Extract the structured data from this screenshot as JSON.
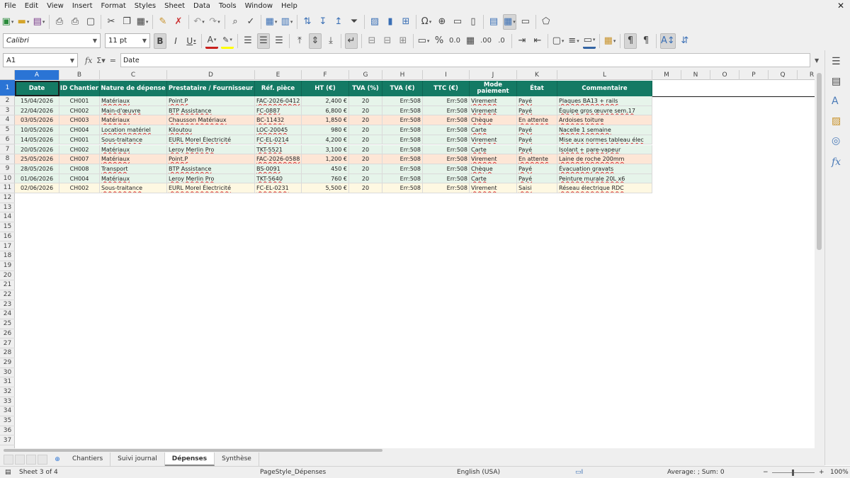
{
  "menu": [
    "File",
    "Edit",
    "View",
    "Insert",
    "Format",
    "Styles",
    "Sheet",
    "Data",
    "Tools",
    "Window",
    "Help"
  ],
  "font": {
    "name": "Calibri",
    "size": "11 pt"
  },
  "namebox": "A1",
  "formula": "Date",
  "columns": [
    "A",
    "B",
    "C",
    "D",
    "E",
    "F",
    "G",
    "H",
    "I",
    "J",
    "K",
    "L",
    "M",
    "N",
    "O",
    "P",
    "Q",
    "R"
  ],
  "header": [
    "Date",
    "ID Chantier",
    "Nature de dépense",
    "Prestataire / Fournisseur",
    "Réf. pièce",
    "HT (€)",
    "TVA (%)",
    "TVA (€)",
    "TTC (€)",
    "Mode paiement",
    "État",
    "Commentaire"
  ],
  "rows": [
    [
      "15/04/2026",
      "CH001",
      "Matériaux",
      "Point.P",
      "FAC-2026-0412",
      "2,400 €",
      "20",
      "Err:508",
      "Err:508",
      "Virement",
      "Payé",
      "Plaques BA13 + rails"
    ],
    [
      "22/04/2026",
      "CH002",
      "Main-d'œuvre",
      "BTP Assistance",
      "FC-0887",
      "6,800 €",
      "20",
      "Err:508",
      "Err:508",
      "Virement",
      "Payé",
      "Équipe gros œuvre sem.17"
    ],
    [
      "03/05/2026",
      "CH003",
      "Matériaux",
      "Chausson Matériaux",
      "BC-11432",
      "1,850 €",
      "20",
      "Err:508",
      "Err:508",
      "Chèque",
      "En attente",
      "Ardoises toiture"
    ],
    [
      "10/05/2026",
      "CH004",
      "Location matériel",
      "Kiloutou",
      "LOC-20045",
      "980 €",
      "20",
      "Err:508",
      "Err:508",
      "Carte",
      "Payé",
      "Nacelle 1 semaine"
    ],
    [
      "14/05/2026",
      "CH001",
      "Sous-traitance",
      "EURL Morel Électricité",
      "FC-EL-0214",
      "4,200 €",
      "20",
      "Err:508",
      "Err:508",
      "Virement",
      "Payé",
      "Mise aux normes tableau élec"
    ],
    [
      "20/05/2026",
      "CH002",
      "Matériaux",
      "Leroy Merlin Pro",
      "TKT-5521",
      "3,100 €",
      "20",
      "Err:508",
      "Err:508",
      "Carte",
      "Payé",
      "Isolant + pare-vapeur"
    ],
    [
      "25/05/2026",
      "CH007",
      "Matériaux",
      "Point.P",
      "FAC-2026-0588",
      "1,200 €",
      "20",
      "Err:508",
      "Err:508",
      "Virement",
      "En attente",
      "Laine de roche 200mm"
    ],
    [
      "28/05/2026",
      "CH008",
      "Transport",
      "BTP Assistance",
      "BS-0091",
      "450 €",
      "20",
      "Err:508",
      "Err:508",
      "Chèque",
      "Payé",
      "Évacuation gravats"
    ],
    [
      "01/06/2026",
      "CH004",
      "Matériaux",
      "Leroy Merlin Pro",
      "TKT-5640",
      "760 €",
      "20",
      "Err:508",
      "Err:508",
      "Carte",
      "Payé",
      "Peinture murale 20L x6"
    ],
    [
      "02/06/2026",
      "CH002",
      "Sous-traitance",
      "EURL Morel Électricité",
      "FC-EL-0231",
      "5,500 €",
      "20",
      "Err:508",
      "Err:508",
      "Virement",
      "Saisi",
      "Réseau électrique RDC"
    ]
  ],
  "row_colors": [
    "#e6f4ea",
    "#e6f4ea",
    "#fde6d6",
    "#e6f4ea",
    "#e6f4ea",
    "#e6f4ea",
    "#fde6d6",
    "#e6f4ea",
    "#e6f4ea",
    "#fef8e2"
  ],
  "row_count": 37,
  "tabs": [
    "Chantiers",
    "Suivi journal",
    "Dépenses",
    "Synthèse"
  ],
  "active_tab": "Dépenses",
  "status": {
    "sheet": "Sheet 3 of 4",
    "pagestyle": "PageStyle_Dépenses",
    "lang": "English (USA)",
    "sum": "Average: ; Sum: 0",
    "zoom": "100%"
  },
  "colors": {
    "header_bg": "#147a64",
    "selection": "#2a74d5"
  }
}
